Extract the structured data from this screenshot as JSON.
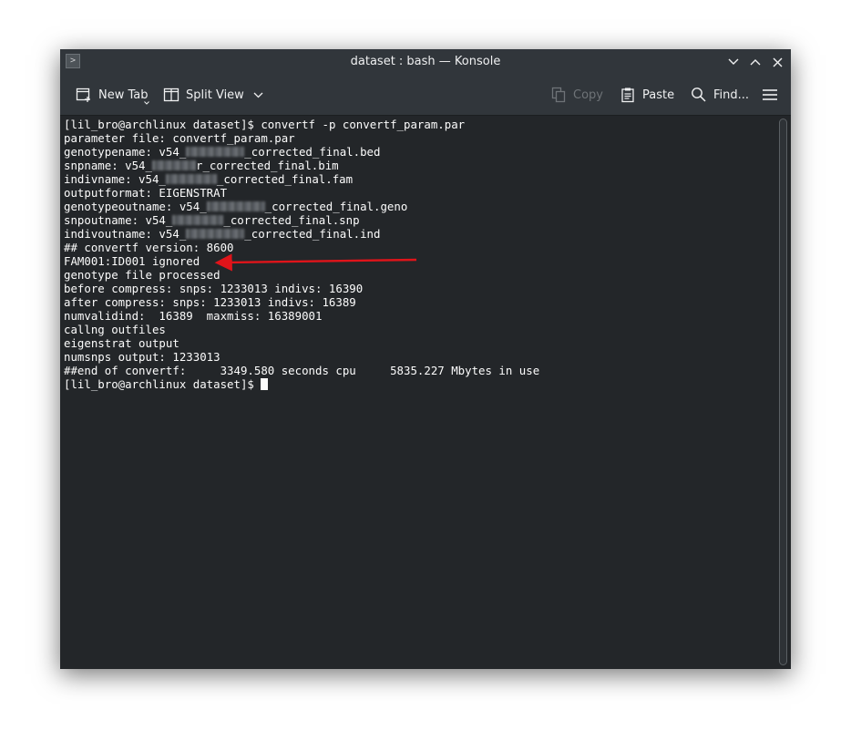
{
  "window": {
    "title": "dataset : bash — Konsole"
  },
  "toolbar": {
    "new_tab": "New Tab",
    "split_view": "Split View",
    "copy": "Copy",
    "paste": "Paste",
    "find": "Find..."
  },
  "terminal": {
    "prompt": "[lil_bro@archlinux dataset]$ ",
    "command": "convertf -p convertf_param.par",
    "lines": {
      "l1": "parameter file: convertf_param.par",
      "l2a": "genotypename: v54_",
      "l2b": "_corrected_final.bed",
      "l3a": "snpname: v54_",
      "l3b": "r_corrected_final.bim",
      "l4a": "indivname: v54_",
      "l4b": "_corrected_final.fam",
      "l5": "outputformat: EIGENSTRAT",
      "l6a": "genotypeoutname: v54_",
      "l6b": "_corrected_final.geno",
      "l7a": "snpoutname: v54_",
      "l7b": "_corrected_final.snp",
      "l8a": "indivoutname: v54_",
      "l8b": "_corrected_final.ind",
      "l9": "## convertf version: 8600",
      "l10": "FAM001:ID001 ignored",
      "l11": "genotype file processed",
      "l12": "before compress: snps: 1233013 indivs: 16390",
      "l13": "after compress: snps: 1233013 indivs: 16389",
      "l14": "numvalidind:  16389  maxmiss: 16389001",
      "l15": "callng outfiles",
      "l16": "eigenstrat output",
      "l17": "numsnps output: 1233013",
      "l18": "##end of convertf:     3349.580 seconds cpu     5835.227 Mbytes in use"
    },
    "final_prompt": "[lil_bro@archlinux dataset]$ "
  },
  "annotation": {
    "arrow_color": "#e0141a"
  },
  "colors": {
    "window_bg": "#232629",
    "chrome_bg": "#31363b",
    "text": "#fcfcfc"
  }
}
